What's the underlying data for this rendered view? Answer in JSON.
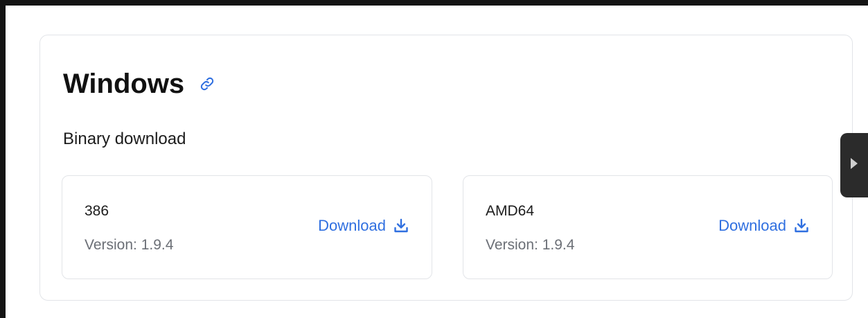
{
  "section": {
    "title": "Windows",
    "subheading": "Binary download"
  },
  "icons": {
    "anchor": "link-icon",
    "download": "download-icon",
    "side_tab": "play-triangle-icon"
  },
  "colors": {
    "link": "#2f6fe0",
    "border": "#e2e4e8",
    "side_tab_bg": "#2b2b2b"
  },
  "binaries": [
    {
      "arch": "386",
      "version": "Version: 1.9.4",
      "download_label": "Download"
    },
    {
      "arch": "AMD64",
      "version": "Version: 1.9.4",
      "download_label": "Download"
    }
  ]
}
